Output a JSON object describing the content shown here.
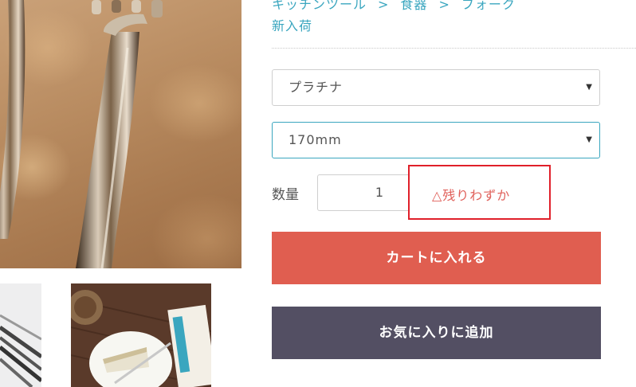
{
  "breadcrumb": {
    "items": [
      "キッチンツール",
      "食器",
      "フォーク"
    ],
    "separator": ">"
  },
  "category_link": "新入荷",
  "options": {
    "color_select": {
      "value": "プラチナ",
      "caret": "▼"
    },
    "size_select": {
      "value": "170mm",
      "caret": "▼"
    }
  },
  "quantity": {
    "label": "数量",
    "value": "1"
  },
  "stock": {
    "text": "△残りわずか"
  },
  "buttons": {
    "add_to_cart": "カートに入れる",
    "add_to_favorites": "お気に入りに追加"
  },
  "colors": {
    "link": "#3aa6bf",
    "cart_button": "#e05e50",
    "favorites_button": "#534f63",
    "stock_highlight_border": "#e0202a",
    "stock_text": "#e0605a",
    "focused_select_border": "#3aa6bf"
  }
}
